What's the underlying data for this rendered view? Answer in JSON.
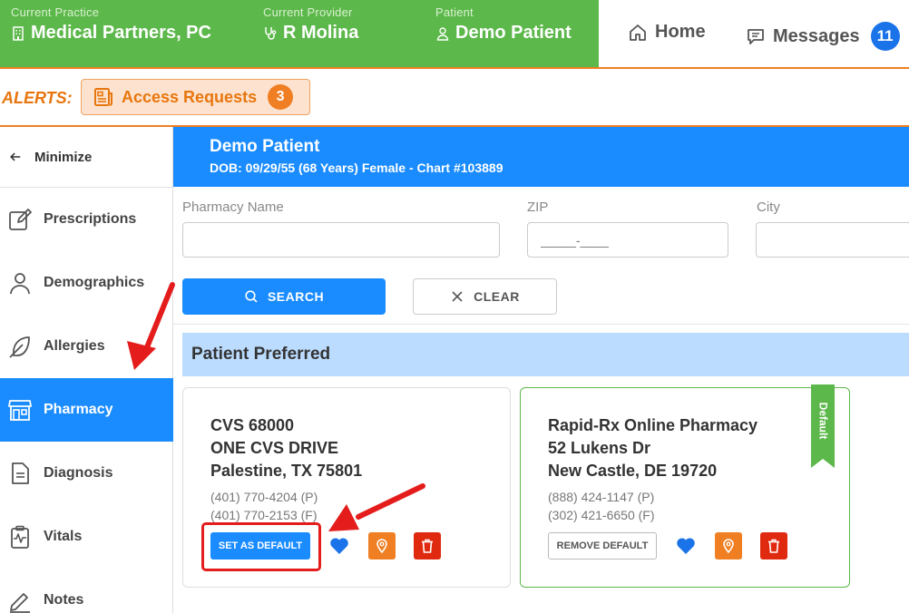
{
  "topbar": {
    "practice_label": "Current Practice",
    "practice_value": "Medical Partners, PC",
    "provider_label": "Current Provider",
    "provider_value": "R Molina",
    "patient_label": "Patient",
    "patient_value": "Demo Patient",
    "home_label": "Home",
    "messages_label": "Messages",
    "messages_count": "11"
  },
  "alerts": {
    "label": "ALERTS:",
    "access_requests_label": "Access Requests",
    "access_requests_count": "3"
  },
  "sidebar": {
    "minimize_label": "Minimize",
    "items": [
      {
        "label": "Prescriptions",
        "icon": "edit-icon"
      },
      {
        "label": "Demographics",
        "icon": "person-icon"
      },
      {
        "label": "Allergies",
        "icon": "feather-icon"
      },
      {
        "label": "Pharmacy",
        "icon": "storefront-icon"
      },
      {
        "label": "Diagnosis",
        "icon": "document-icon"
      },
      {
        "label": "Vitals",
        "icon": "clipboard-pulse-icon"
      },
      {
        "label": "Notes",
        "icon": "pen-icon"
      }
    ],
    "active": "Pharmacy"
  },
  "patient_header": {
    "name": "Demo Patient",
    "details": "DOB: 09/29/55 (68 Years) Female - Chart #103889"
  },
  "search": {
    "pharmacy_name_label": "Pharmacy Name",
    "pharmacy_name_value": "",
    "zip_label": "ZIP",
    "zip_value": "_____-____",
    "city_label": "City",
    "city_value": "",
    "search_button": "SEARCH",
    "clear_button": "CLEAR"
  },
  "preferred": {
    "title": "Patient Preferred",
    "cards": [
      {
        "name": "CVS 68000",
        "address1": "ONE CVS DRIVE",
        "address2": "Palestine, TX 75801",
        "phone": "(401) 770-4204 (P)",
        "fax": "(401) 770-2153 (F)",
        "action_button": "SET AS DEFAULT",
        "is_default": false
      },
      {
        "name": "Rapid-Rx Online Pharmacy",
        "address1": "52 Lukens Dr",
        "address2": "New Castle, DE 19720",
        "phone": "(888) 424-1147 (P)",
        "fax": "(302) 421-6650 (F)",
        "action_button": "REMOVE DEFAULT",
        "is_default": true,
        "ribbon_label": "Default"
      }
    ]
  },
  "colors": {
    "brand_green": "#5cb84a",
    "brand_blue": "#1a8cff",
    "alert_orange": "#f07e22",
    "delete_red": "#e02a10",
    "annotation_red": "#e41c1c"
  }
}
